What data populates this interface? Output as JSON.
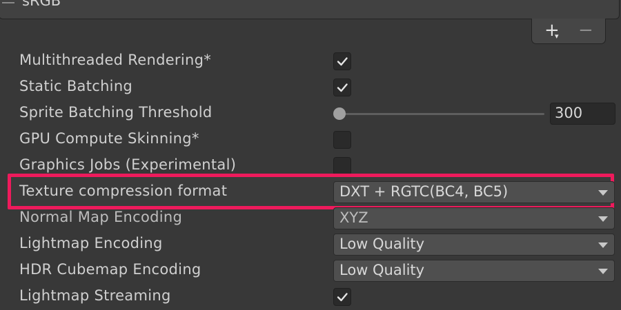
{
  "header": {
    "list_item_label": "sRGB",
    "add_label": "+",
    "add_dropdown_indicator": "▾",
    "remove_label": "−"
  },
  "settings": [
    {
      "label": "Multithreaded Rendering*",
      "control": "checkbox",
      "checked": true
    },
    {
      "label": "Static Batching",
      "control": "checkbox",
      "checked": true
    },
    {
      "label": "Sprite Batching Threshold",
      "control": "slider",
      "value": "300",
      "slider_fraction": 0.0
    },
    {
      "label": "GPU Compute Skinning*",
      "control": "checkbox",
      "checked": false
    },
    {
      "label": "Graphics Jobs (Experimental)",
      "control": "checkbox",
      "checked": false
    },
    {
      "label": "Texture compression format",
      "control": "dropdown",
      "value": "DXT + RGTC(BC4, BC5)",
      "highlighted": true
    },
    {
      "label": "Normal Map Encoding",
      "control": "dropdown",
      "value": "XYZ"
    },
    {
      "label": "Lightmap Encoding",
      "control": "dropdown",
      "value": "Low Quality"
    },
    {
      "label": "HDR Cubemap Encoding",
      "control": "dropdown",
      "value": "Low Quality"
    },
    {
      "label": "Lightmap Streaming",
      "control": "checkbox",
      "checked": true
    }
  ],
  "colors": {
    "background": "#383838",
    "highlight": "#ee1a5c",
    "text": "#d2d2d2"
  },
  "icons": {
    "checkmark": "check-icon",
    "dropdown": "chevron-down-icon",
    "drag_handle": "drag-handle-icon"
  }
}
